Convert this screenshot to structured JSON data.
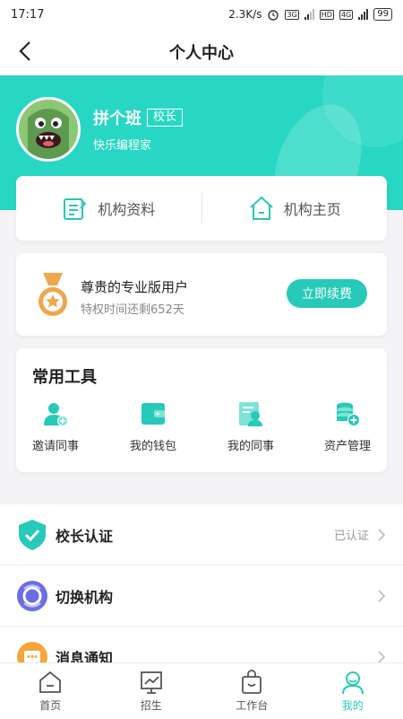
{
  "status_bar": {
    "time": "17:17",
    "speed": "2.3K/s",
    "net1": "3G",
    "hd": "HD",
    "net2": "4G",
    "battery": "99"
  },
  "header": {
    "title": "个人中心"
  },
  "profile": {
    "name": "拼个班",
    "role": "校长",
    "subtitle": "快乐编程家"
  },
  "quick_links": [
    {
      "label": "机构资料",
      "icon": "edit-doc-icon"
    },
    {
      "label": "机构主页",
      "icon": "home-icon"
    }
  ],
  "vip": {
    "title": "尊贵的专业版用户",
    "subtitle": "特权时间还剩652天",
    "button": "立即续费"
  },
  "tools": {
    "title": "常用工具",
    "items": [
      {
        "label": "邀请同事",
        "icon": "invite-user-icon"
      },
      {
        "label": "我的钱包",
        "icon": "wallet-icon"
      },
      {
        "label": "我的同事",
        "icon": "colleague-card-icon"
      },
      {
        "label": "资产管理",
        "icon": "asset-coins-icon"
      }
    ]
  },
  "menu": [
    {
      "label": "校长认证",
      "status": "已认证",
      "icon": "shield-check-icon"
    },
    {
      "label": "切换机构",
      "status": "",
      "icon": "switch-org-icon"
    },
    {
      "label": "消息通知",
      "status": "",
      "icon": "message-icon"
    }
  ],
  "tabbar": [
    {
      "label": "首页",
      "icon": "home-tab-icon"
    },
    {
      "label": "招生",
      "icon": "chart-tab-icon"
    },
    {
      "label": "工作台",
      "icon": "bag-tab-icon"
    },
    {
      "label": "我的",
      "icon": "profile-tab-icon",
      "active": true
    }
  ],
  "colors": {
    "accent": "#27d7c3",
    "button": "#27c9b8",
    "medal": "#f0a64c",
    "switch_icon": "#6a6fe0",
    "message_icon": "#f3a63a"
  }
}
